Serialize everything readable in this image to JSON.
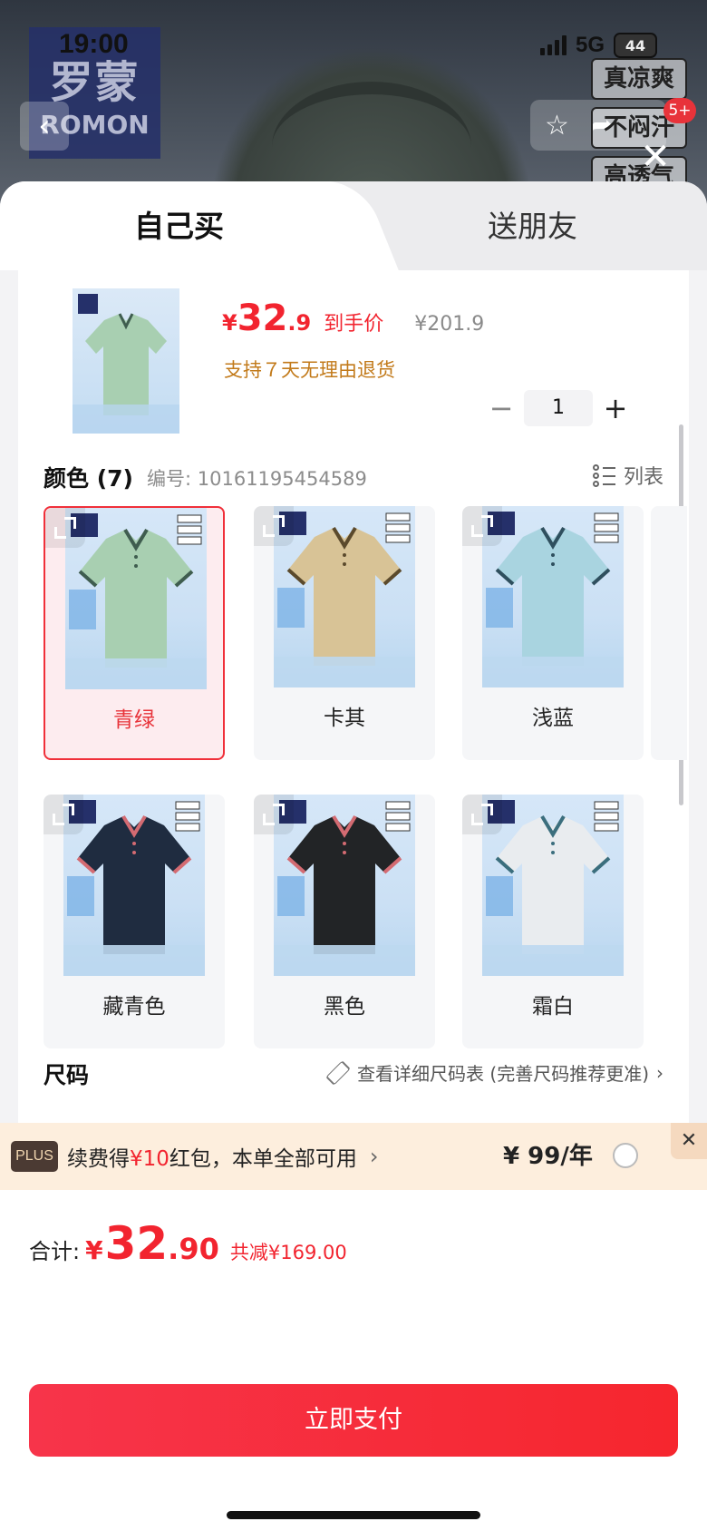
{
  "status_bar": {
    "time": "19:00",
    "network": "5G",
    "battery": "44"
  },
  "background_page": {
    "logo_cn": "罗蒙",
    "logo_en": "ROMON",
    "tags": [
      "真凉爽",
      "不闷汗",
      "高透气"
    ],
    "cart_badge": "5+"
  },
  "tabs": {
    "buy_self": "自己买",
    "gift_friend": "送朋友"
  },
  "product": {
    "price_yen": "¥",
    "price_int": "32",
    "price_dec": ".9",
    "price_label": "到手价",
    "original_price": "¥201.9",
    "return_note": "支持７天无理由退货",
    "quantity": "1",
    "qty_minus": "−",
    "qty_plus": "+"
  },
  "color_section": {
    "title": "颜色 (7)",
    "code_label": "编号: 10161195454589",
    "list_toggle": "列表",
    "options": [
      {
        "name": "青绿",
        "color": "#a8cfb1",
        "trim": "#3f5d4f",
        "selected": true
      },
      {
        "name": "卡其",
        "color": "#d8c396",
        "trim": "#5b4a2c",
        "selected": false
      },
      {
        "name": "浅蓝",
        "color": "#a9d4e0",
        "trim": "#2f4f5e",
        "selected": false
      },
      {
        "name": "藏青色",
        "color": "#1f2c40",
        "trim": "#d46b72",
        "selected": false
      },
      {
        "name": "黑色",
        "color": "#222426",
        "trim": "#d46b72",
        "selected": false
      },
      {
        "name": "霜白",
        "color": "#e9ecef",
        "trim": "#3b6e7d",
        "selected": false
      }
    ]
  },
  "size_section": {
    "title": "尺码",
    "guide_link": "查看详细尺码表 (完善尺码推荐更准)"
  },
  "plus_banner": {
    "badge": "PLUS",
    "text_pre": "续费得",
    "text_highlight": "¥10",
    "text_post": "红包，本单全部可用",
    "price": "¥ 99/年"
  },
  "footer": {
    "total_label": "合计:",
    "total_yen": "¥",
    "total_int": "32",
    "total_dec": ".90",
    "saved": "共减¥169.00",
    "pay_button": "立即支付"
  },
  "colors": {
    "accent_red": "#f2242f",
    "return_note": "#c27a1a"
  }
}
